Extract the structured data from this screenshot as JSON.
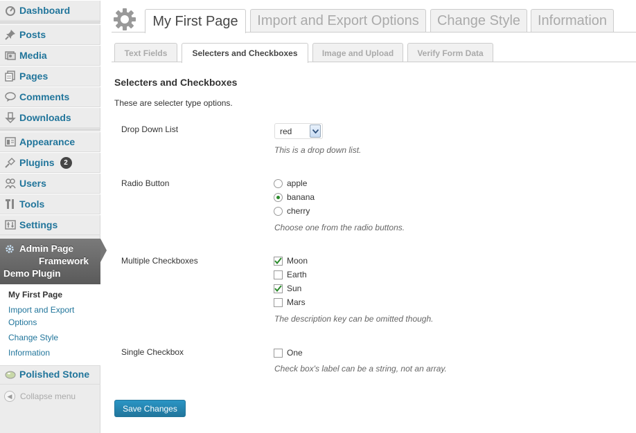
{
  "sidebar": {
    "menu": [
      {
        "label": "Dashboard",
        "icon": "dashboard-icon"
      },
      {
        "label": "Posts",
        "icon": "pushpin-icon"
      },
      {
        "label": "Media",
        "icon": "media-icon"
      },
      {
        "label": "Pages",
        "icon": "pages-icon"
      },
      {
        "label": "Comments",
        "icon": "comment-bubble-icon"
      },
      {
        "label": "Downloads",
        "icon": "download-icon"
      },
      {
        "label": "Appearance",
        "icon": "appearance-icon"
      },
      {
        "label": "Plugins",
        "icon": "plug-icon",
        "badge": "2"
      },
      {
        "label": "Users",
        "icon": "users-icon"
      },
      {
        "label": "Tools",
        "icon": "tools-icon"
      },
      {
        "label": "Settings",
        "icon": "settings-icon"
      }
    ],
    "active_menu": {
      "line1": "Admin Page",
      "line2": "Framework",
      "line3": "Demo Plugin",
      "icon": "gear-icon"
    },
    "submenu": [
      "My First Page",
      "Import and Export",
      "Options",
      "Change Style",
      "Information"
    ],
    "extra_menu": {
      "label": "Polished Stone",
      "icon": "stone-icon"
    },
    "collapse_label": "Collapse menu"
  },
  "page_tabs": [
    {
      "label": "My First Page",
      "active": true
    },
    {
      "label": "Import and Export Options",
      "active": false
    },
    {
      "label": "Change Style",
      "active": false
    },
    {
      "label": "Information",
      "active": false
    }
  ],
  "sub_tabs": [
    {
      "label": "Text Fields",
      "active": false
    },
    {
      "label": "Selecters and Checkboxes",
      "active": true
    },
    {
      "label": "Image and Upload",
      "active": false
    },
    {
      "label": "Verify Form Data",
      "active": false
    }
  ],
  "section": {
    "title": "Selecters and Checkboxes",
    "description": "These are selecter type options."
  },
  "fields": {
    "dropdown": {
      "label": "Drop Down List",
      "value": "red",
      "description": "This is a drop down list."
    },
    "radio": {
      "label": "Radio Button",
      "options": [
        {
          "label": "apple",
          "checked": false
        },
        {
          "label": "banana",
          "checked": true
        },
        {
          "label": "cherry",
          "checked": false
        }
      ],
      "description": "Choose one from the radio buttons."
    },
    "checkboxes": {
      "label": "Multiple Checkboxes",
      "options": [
        {
          "label": "Moon",
          "checked": true
        },
        {
          "label": "Earth",
          "checked": false
        },
        {
          "label": "Sun",
          "checked": true
        },
        {
          "label": "Mars",
          "checked": false
        }
      ],
      "description": "The description key can be omitted though."
    },
    "single": {
      "label": "Single Checkbox",
      "option": "One",
      "checked": false,
      "description": "Check box's label can be a string, not an array."
    }
  },
  "save_label": "Save Changes",
  "colors": {
    "link": "#21759b",
    "accent_button": "#21759b",
    "check_green": "#2a8a2a"
  }
}
